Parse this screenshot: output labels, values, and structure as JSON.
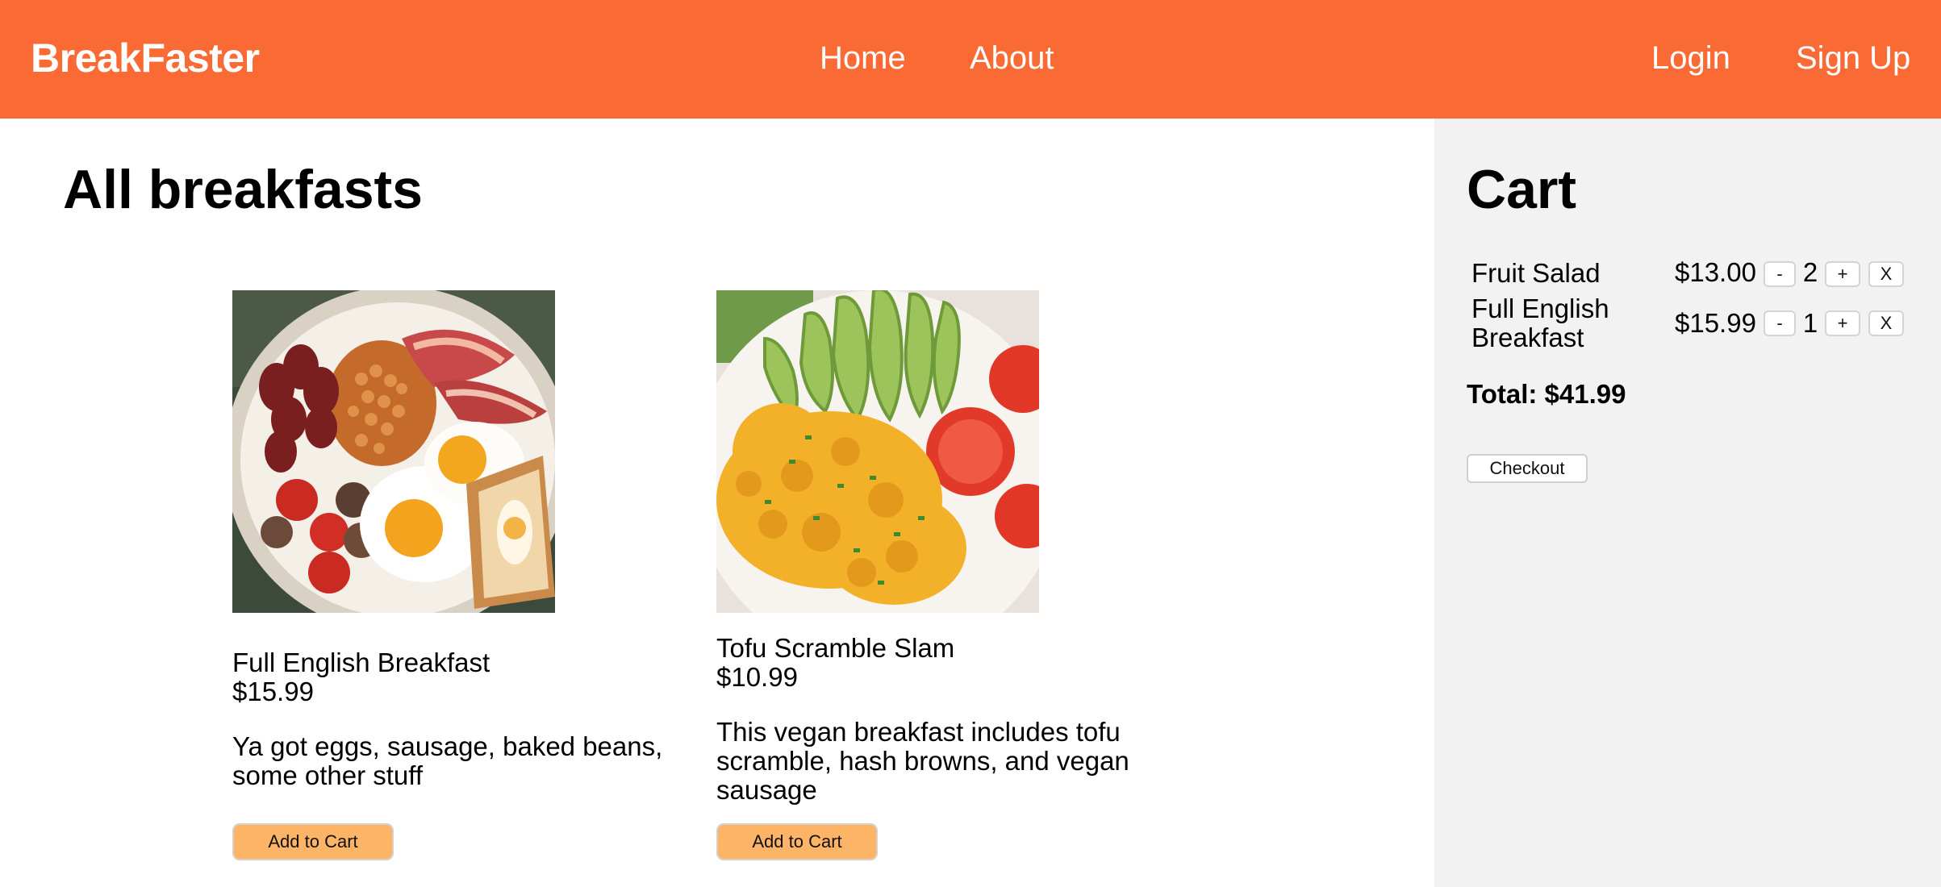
{
  "header": {
    "brand": "BreakFaster",
    "nav": {
      "home": "Home",
      "about": "About"
    },
    "auth": {
      "login": "Login",
      "signup": "Sign Up"
    },
    "background_color": "#f96a35"
  },
  "main": {
    "title": "All breakfasts",
    "products": [
      {
        "name": "Full English Breakfast",
        "price": "$15.99",
        "description": "Ya got eggs, sausage, baked beans, some other stuff",
        "button_label": "Add to Cart"
      },
      {
        "name": "Tofu Scramble Slam",
        "price": "$10.99",
        "description": "This vegan breakfast includes tofu scramble, hash browns, and vegan sausage",
        "button_label": "Add to Cart"
      }
    ],
    "button_color": "#fdb466"
  },
  "cart": {
    "title": "Cart",
    "items": [
      {
        "name": "Fruit Salad",
        "price": "$13.00",
        "quantity": "2"
      },
      {
        "name": "Full English Breakfast",
        "price": "$15.99",
        "quantity": "1"
      }
    ],
    "controls": {
      "decrement": "-",
      "increment": "+",
      "remove": "X"
    },
    "total": "Total: $41.99",
    "checkout_label": "Checkout",
    "background_color": "#f2f2f2"
  }
}
